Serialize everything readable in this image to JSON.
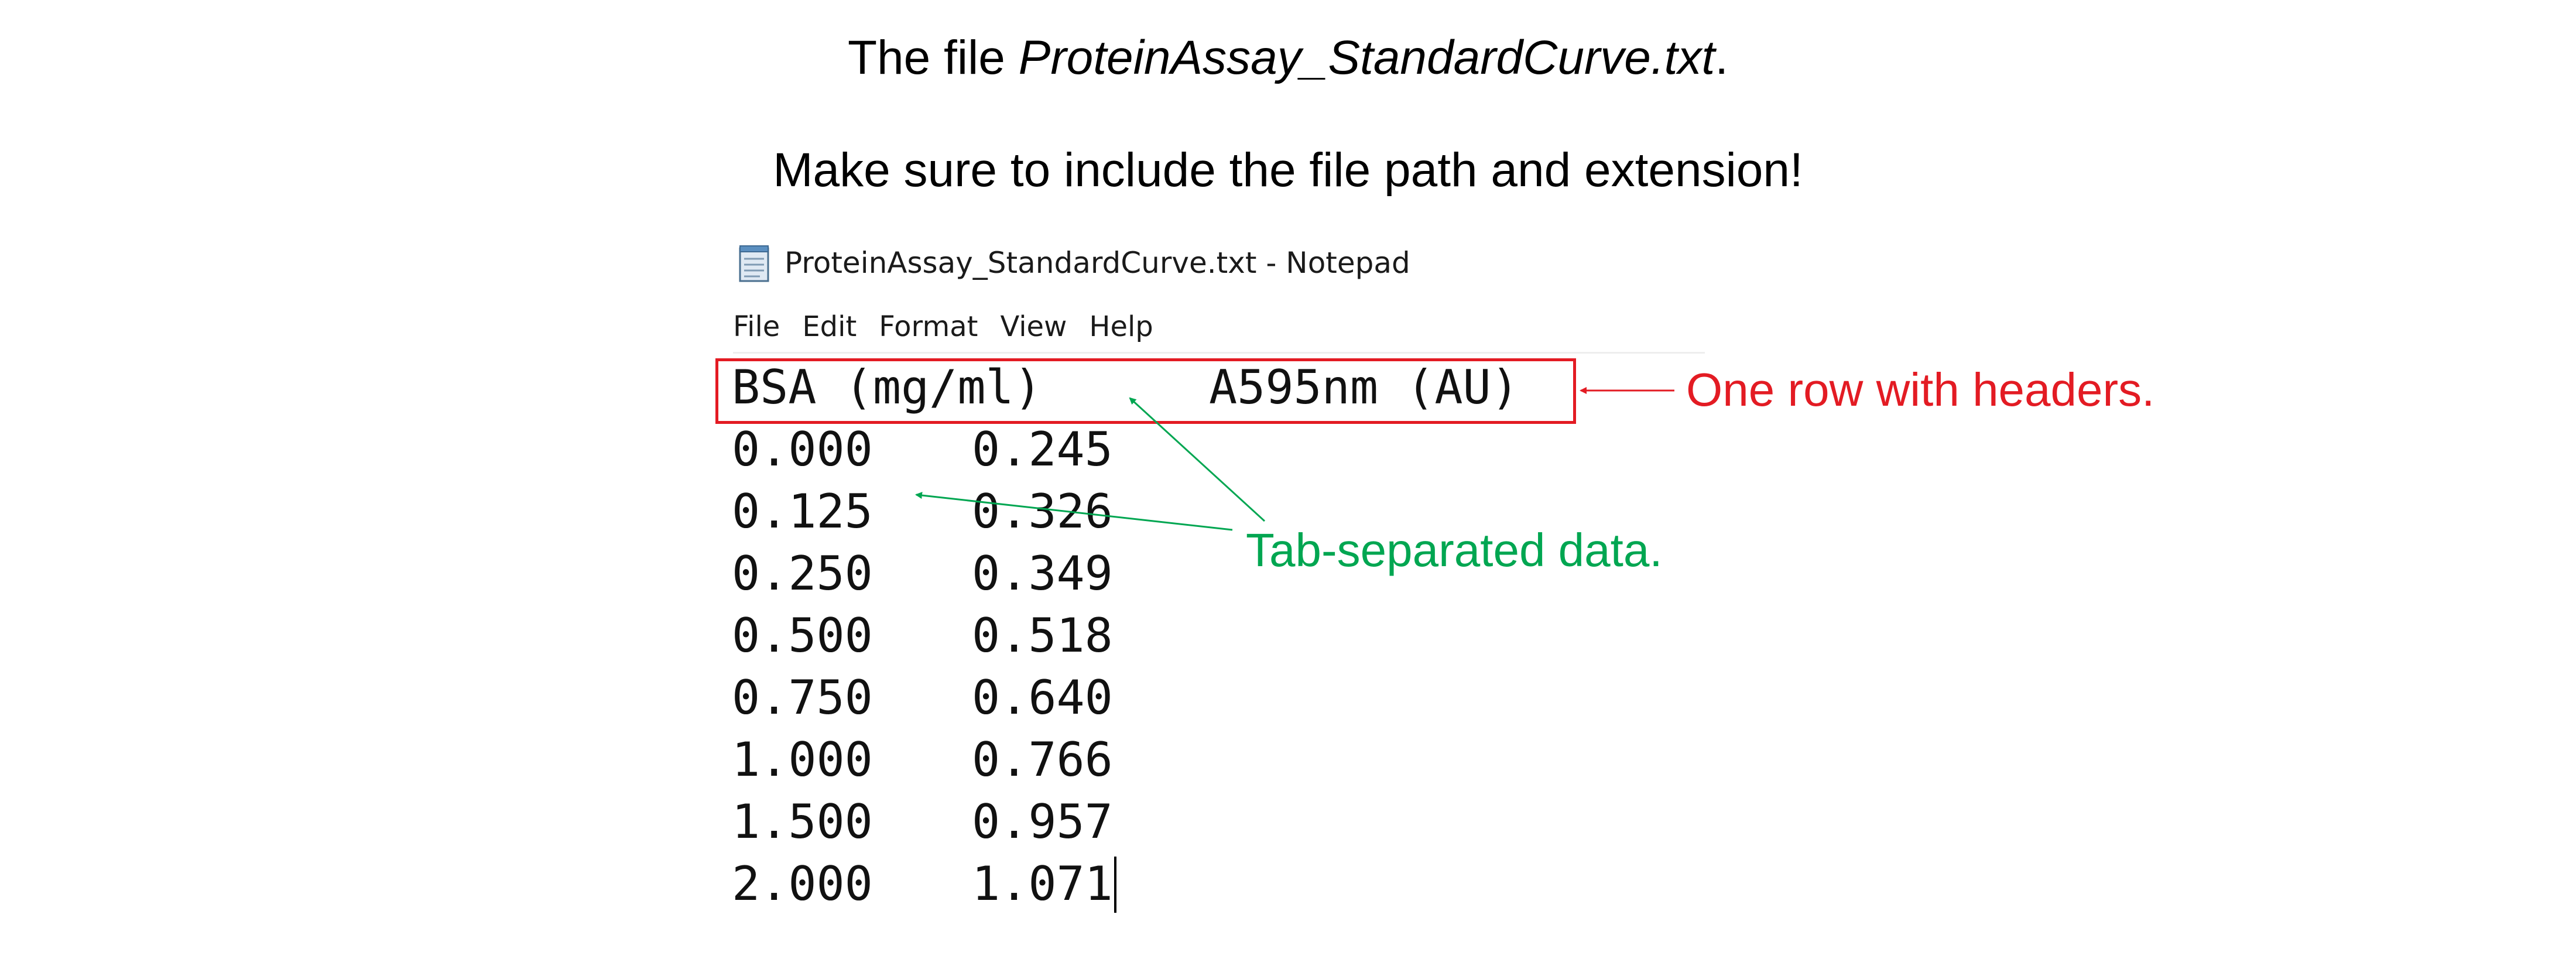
{
  "captions": {
    "line1_prefix": "The file ",
    "line1_filename": "ProteinAssay_StandardCurve.txt",
    "line1_suffix": ".",
    "line2": "Make sure to include the file path and extension!"
  },
  "window": {
    "title": "ProteinAssay_StandardCurve.txt - Notepad",
    "app_icon": "notepad-icon"
  },
  "menu": {
    "items": [
      "File",
      "Edit",
      "Format",
      "View",
      "Help"
    ]
  },
  "file_content": {
    "header": [
      "BSA (mg/ml)",
      "A595nm (AU)"
    ],
    "rows": [
      [
        "0.000",
        "0.245"
      ],
      [
        "0.125",
        "0.326"
      ],
      [
        "0.250",
        "0.349"
      ],
      [
        "0.500",
        "0.518"
      ],
      [
        "0.750",
        "0.640"
      ],
      [
        "1.000",
        "0.766"
      ],
      [
        "1.500",
        "0.957"
      ],
      [
        "2.000",
        "1.071"
      ]
    ]
  },
  "annotations": {
    "headers": "One row with headers.",
    "tab_separated": "Tab-separated data."
  },
  "colors": {
    "header_annotation": "#e31b23",
    "tab_annotation": "#00a651"
  }
}
